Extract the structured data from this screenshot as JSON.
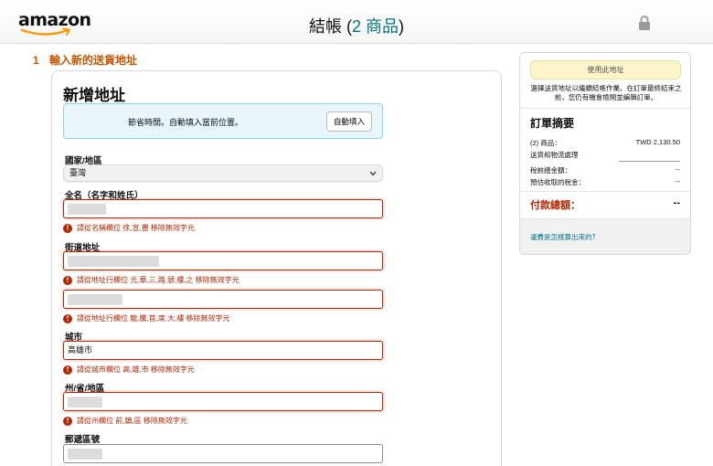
{
  "header": {
    "logo": "amazon",
    "title": "結帳",
    "count": "2 商品",
    "open_paren": "(",
    "close_paren": ")"
  },
  "step": {
    "number": "1",
    "label": "輸入新的送貨地址"
  },
  "form": {
    "title": "新增地址",
    "autofill_text": "節省時間。自動填入當前位置。",
    "autofill_button": "自動填入",
    "country_label": "國家/地區",
    "country_value": "臺灣",
    "name_label": "全名（名字和姓氏）",
    "name_error": "請從名稱欄位 徐,宣,豐 移除無效字元",
    "street_label": "街道地址",
    "street_error_1": "請從地址行欄位 光,華,三,路,號,樓,之 移除無效字元",
    "street_error_2": "請從地址行欄位 龍,騰,首,席,大,樓 移除無效字元",
    "city_label": "城市",
    "city_value": "高雄市",
    "city_error": "請從城市欄位 高,雄,市 移除無效字元",
    "state_label": "州/省/地區",
    "state_error": "請從州欄位 前,鎮,區 移除無效字元",
    "zip_label": "郵遞區號",
    "error_icon": "!"
  },
  "sidebar": {
    "use_address_button": "使用此地址",
    "note": "選擇送貨地址以繼續結帳作業。在訂單最終結束之前，您仍有機會檢閱並編輯訂單。",
    "summary_title": "訂單摘要",
    "rows": [
      {
        "label": "(2) 商品：",
        "value": "TWD 2,130.50"
      },
      {
        "label": "送貨和物流處理",
        "value": ""
      },
      {
        "label": "稅前總金額：",
        "value": "--"
      },
      {
        "label": "預估收取的稅金：",
        "value": "--"
      }
    ],
    "total_label": "付款總額：",
    "total_value": "--",
    "link": "運費是怎樣算出來的？"
  },
  "colors": {
    "accent_orange": "#c45500",
    "error_red": "#b12704",
    "link_teal": "#007185",
    "autofill_bg": "#e6f6fb",
    "use_button_bg": "#fcf5c9"
  },
  "icons": [
    "amazon-logo",
    "lock-icon",
    "chevron-down-icon",
    "error-icon"
  ]
}
